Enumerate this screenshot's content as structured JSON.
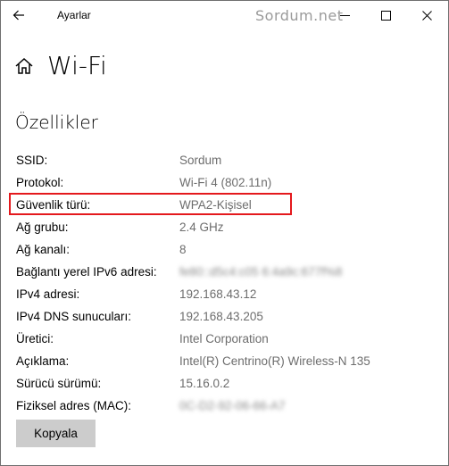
{
  "titlebar": {
    "app_title": "Ayarlar",
    "watermark": "Sordum.net",
    "back_icon": "arrow-left-icon",
    "minimize_icon": "minimize-icon",
    "maximize_icon": "maximize-icon",
    "close_icon": "close-icon"
  },
  "header": {
    "home_icon": "home-icon",
    "title": "Wi-Fi"
  },
  "section": {
    "title": "Özellikler"
  },
  "properties": [
    {
      "label": "SSID:",
      "value": "Sordum"
    },
    {
      "label": "Protokol:",
      "value": "Wi-Fi 4 (802.11n)"
    },
    {
      "label": "Güvenlik türü:",
      "value": "WPA2-Kişisel"
    },
    {
      "label": "Ağ grubu:",
      "value": "2.4 GHz"
    },
    {
      "label": "Ağ kanalı:",
      "value": "8"
    },
    {
      "label": "Bağlantı yerel IPv6 adresi:",
      "value": "fe80::d5c4:c05 6:4a9c:677f%8"
    },
    {
      "label": "IPv4 adresi:",
      "value": "192.168.43.12"
    },
    {
      "label": "IPv4 DNS sunucuları:",
      "value": "192.168.43.205"
    },
    {
      "label": "Üretici:",
      "value": "Intel Corporation"
    },
    {
      "label": "Açıklama:",
      "value": "Intel(R) Centrino(R) Wireless-N 135"
    },
    {
      "label": "Sürücü sürümü:",
      "value": "15.16.0.2"
    },
    {
      "label": "Fiziksel adres (MAC):",
      "value": "0C-D2-92-06-66-A7"
    }
  ],
  "highlight_color": "#e4191d",
  "copy_button": {
    "label": "Kopyala"
  }
}
